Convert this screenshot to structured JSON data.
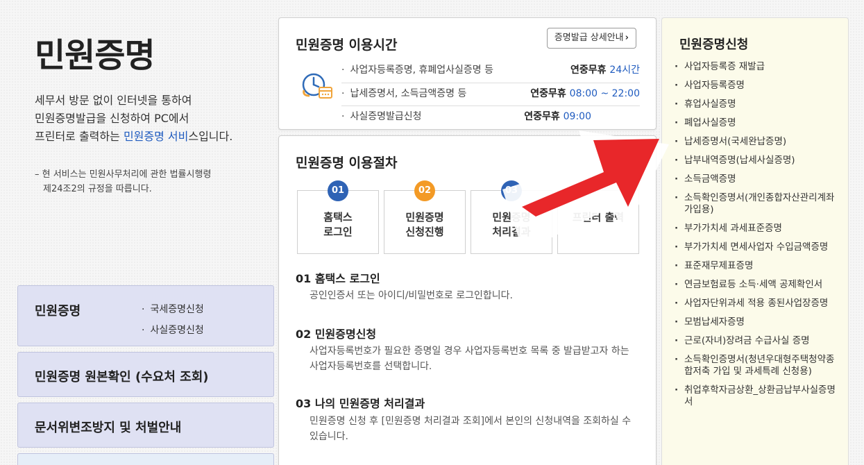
{
  "left": {
    "page_title": "민원증명",
    "intro_line1": "세무서 방문 없이 인터넷을 통하여",
    "intro_line2": "민원증명발급을 신청하여 PC에서",
    "intro_line3_pre": "프린터로 출력하는 ",
    "intro_line3_hl": "민원증명 서비",
    "intro_line3_post": "스입니다.",
    "note_line1": "– 현 서비스는 민원사무처리에 관한 법률시행령",
    "note_line2": "  제24조2의 규정을 따릅니다.",
    "menu": {
      "item1_title": "민원증명",
      "item1_sub1": "국세증명신청",
      "item1_sub2": "사실증명신청",
      "item2_title": "민원증명 원본확인 (수요처 조회)",
      "item3_title": "문서위변조방지 및 처벌안내"
    }
  },
  "hours": {
    "title": "민원증명 이용시간",
    "detail_button": "증명발급 상세안내",
    "rows": [
      {
        "label": "사업자등록증명, 휴폐업사실증명 등",
        "prefix": "연중무휴 ",
        "time": "24시간"
      },
      {
        "label": "납세증명서, 소득금액증명 등",
        "prefix": "연중무휴 ",
        "time": "08:00 ~ 22:00"
      },
      {
        "label": "사실증명발급신청",
        "prefix": "연중무휴 ",
        "time": "09:00"
      }
    ]
  },
  "procedure": {
    "title": "민원증명 이용절차",
    "steps": [
      {
        "num": "01",
        "line1": "홈택스",
        "line2": "로그인"
      },
      {
        "num": "02",
        "line1": "민원증명",
        "line2": "신청진행"
      },
      {
        "num": "03",
        "line1": "민원증명",
        "line2": "처리결과"
      },
      {
        "num": "04",
        "line1": "",
        "line2": "프린터 출력"
      }
    ],
    "sections": [
      {
        "title": "01 홈택스 로그인",
        "body": "공인인증서 또는 아이디/비밀번호로 로그인합니다."
      },
      {
        "title": "02 민원증명신청",
        "body": "사업자등록번호가 필요한 증명일 경우 사업자등록번호 목록 중 발급받고자 하는 사업자등록번호를 선택합니다."
      },
      {
        "title": "03 나의 민원증명 처리결과",
        "body": "민원증명 신청 후 [민원증명 처리결과 조회]에서 본인의 신청내역을 조회하실 수 있습니다."
      }
    ]
  },
  "apply": {
    "title": "민원증명신청",
    "items": [
      "사업자등록증 재발급",
      "사업자등록증명",
      "휴업사실증명",
      "폐업사실증명",
      "납세증명서(국세완납증명)",
      "납부내역증명(납세사실증명)",
      "소득금액증명",
      "소득확인증명서(개인종합자산관리계좌 가입용)",
      "부가가치세 과세표준증명",
      "부가가치세 면세사업자 수입금액증명",
      "표준재무제표증명",
      "연금보험료등 소득·세액 공제확인서",
      "사업자단위과세 적용 종된사업장증명",
      "모범납세자증명",
      "근로(자녀)장려금 수급사실 증명",
      "소득확인증명서(청년우대형주택청약종합저축 가입 및 과세특례 신청용)",
      "취업후학자금상환_상환금납부사실증명서"
    ]
  },
  "colors": {
    "accent_blue": "#1f5bbf",
    "step_orange": "#f39a25",
    "step_blue": "#2f63b5",
    "arrow_red": "#e8272a",
    "menu_bg": "#dfe1f3",
    "apply_bg": "#fcfbea"
  },
  "icons": {
    "clock": "clock-calendar-icon",
    "arrow": "red-arrow-icon"
  }
}
